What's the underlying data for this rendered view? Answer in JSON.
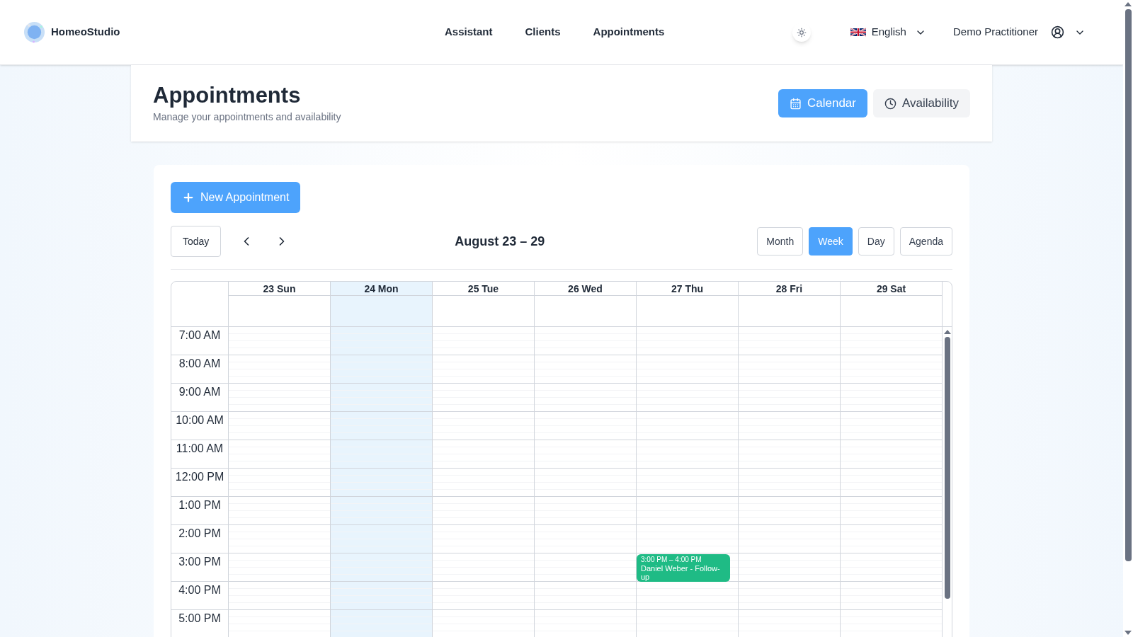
{
  "brand": {
    "name": "HomeoStudio"
  },
  "nav": [
    {
      "label": "Assistant"
    },
    {
      "label": "Clients"
    },
    {
      "label": "Appointments"
    }
  ],
  "header_right": {
    "language": "English",
    "user": "Demo Practitioner"
  },
  "page": {
    "title": "Appointments",
    "subtitle": "Manage your appointments and availability"
  },
  "view_toggle": [
    {
      "label": "Calendar",
      "kind": "calendar",
      "selected": true
    },
    {
      "label": "Availability",
      "kind": "clock",
      "selected": false
    }
  ],
  "new_button": {
    "label": "New Appointment"
  },
  "toolbar": {
    "today": "Today",
    "range": "August 23 – 29",
    "views": [
      {
        "label": "Month",
        "selected": false
      },
      {
        "label": "Week",
        "selected": true
      },
      {
        "label": "Day",
        "selected": false
      },
      {
        "label": "Agenda",
        "selected": false
      }
    ]
  },
  "calendar": {
    "days": [
      {
        "label": "23 Sun",
        "today": false
      },
      {
        "label": "24 Mon",
        "today": true
      },
      {
        "label": "25 Tue",
        "today": false
      },
      {
        "label": "26 Wed",
        "today": false
      },
      {
        "label": "27 Thu",
        "today": false,
        "events": [
          {
            "time": "3:00 PM – 4:00 PM",
            "title": "Daniel Weber - Follow-up",
            "color": "#1fbb85"
          }
        ]
      },
      {
        "label": "28 Fri",
        "today": false
      },
      {
        "label": "29 Sat",
        "today": false
      }
    ],
    "hours": [
      "7:00 AM",
      "8:00 AM",
      "9:00 AM",
      "10:00 AM",
      "11:00 AM",
      "12:00 PM",
      "1:00 PM",
      "2:00 PM",
      "3:00 PM",
      "4:00 PM",
      "5:00 PM"
    ]
  }
}
